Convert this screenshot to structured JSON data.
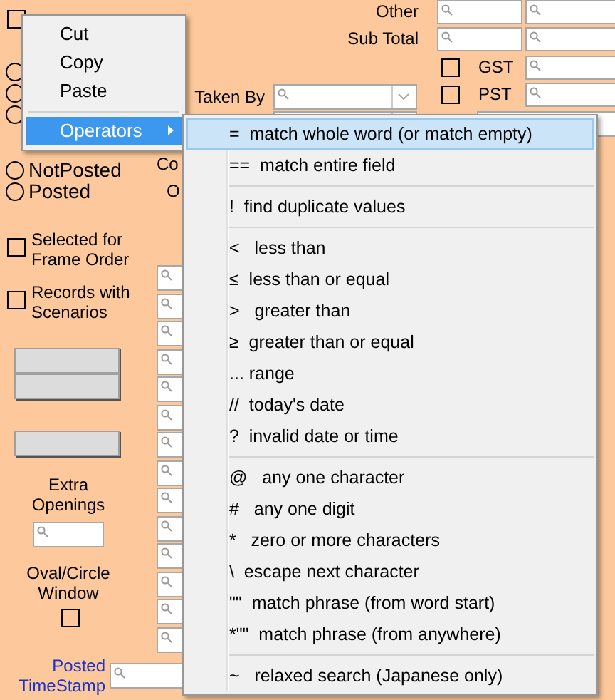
{
  "form": {
    "top_checkbox": {
      "checked": false
    },
    "hidden_radios": [
      {
        "selected": false
      },
      {
        "selected": false
      },
      {
        "selected": false
      }
    ],
    "totals": [
      {
        "label": "Other"
      },
      {
        "label": "Sub Total"
      }
    ],
    "taxes": [
      {
        "label": "GST",
        "checked": false
      },
      {
        "label": "PST",
        "checked": false
      }
    ],
    "taken_by": {
      "label": "Taken By"
    },
    "fragments": [
      "Co",
      "O"
    ],
    "post_filter": [
      {
        "label": "NotPosted",
        "selected": false
      },
      {
        "label": "Posted",
        "selected": false
      }
    ],
    "options": [
      {
        "label": "Selected for Frame Order",
        "checked": false
      },
      {
        "label": "Records with Scenarios",
        "checked": false
      }
    ],
    "extra_openings": {
      "label": "Extra Openings"
    },
    "oval_window": {
      "label": "Oval/Circle Window",
      "checked": false
    },
    "posted_timestamp": {
      "label": "Posted TimeStamp"
    }
  },
  "context_menu": {
    "items": [
      {
        "kind": "item",
        "label": "Cut",
        "selected": false
      },
      {
        "kind": "item",
        "label": "Copy",
        "selected": false
      },
      {
        "kind": "item",
        "label": "Paste",
        "selected": false
      },
      {
        "kind": "separator"
      },
      {
        "kind": "submenu",
        "label": "Operators",
        "selected": true
      }
    ]
  },
  "operators_menu": {
    "items": [
      {
        "kind": "item",
        "label": "=  match whole word (or match empty)",
        "selected": true
      },
      {
        "kind": "item",
        "label": "==  match entire field",
        "selected": false
      },
      {
        "kind": "separator"
      },
      {
        "kind": "item",
        "label": "!  find duplicate values",
        "selected": false
      },
      {
        "kind": "separator"
      },
      {
        "kind": "item",
        "label": "<   less than",
        "selected": false
      },
      {
        "kind": "item",
        "label": "≤  less than or equal",
        "selected": false
      },
      {
        "kind": "item",
        "label": ">   greater than",
        "selected": false
      },
      {
        "kind": "item",
        "label": "≥  greater than or equal",
        "selected": false
      },
      {
        "kind": "item",
        "label": "... range",
        "selected": false
      },
      {
        "kind": "item",
        "label": "//  today's date",
        "selected": false
      },
      {
        "kind": "item",
        "label": "?  invalid date or time",
        "selected": false
      },
      {
        "kind": "separator"
      },
      {
        "kind": "item",
        "label": "@   any one character",
        "selected": false
      },
      {
        "kind": "item",
        "label": "#   any one digit",
        "selected": false
      },
      {
        "kind": "item",
        "label": "*   zero or more characters",
        "selected": false
      },
      {
        "kind": "item",
        "label": "\\  escape next character",
        "selected": false
      },
      {
        "kind": "item",
        "label": "\"\"  match phrase (from word start)",
        "selected": false
      },
      {
        "kind": "item",
        "label": "*\"\"  match phrase (from anywhere)",
        "selected": false
      },
      {
        "kind": "separator"
      },
      {
        "kind": "item",
        "label": "~   relaxed search (Japanese only)",
        "selected": false
      }
    ]
  }
}
